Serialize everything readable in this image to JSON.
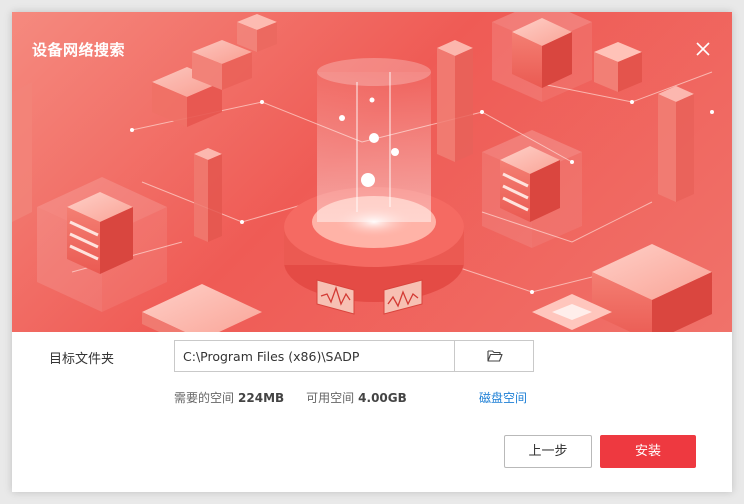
{
  "window": {
    "title": "设备网络搜索"
  },
  "icons": {
    "close": "close-icon",
    "browse": "folder-open-icon"
  },
  "install_dir": {
    "label": "目标文件夹",
    "value": "C:\\Program Files (x86)\\SADP"
  },
  "space": {
    "required_label": "需要的空间",
    "required_value": "224MB",
    "available_label": "可用空间",
    "available_value": "4.00GB",
    "disk_link": "磁盘空间"
  },
  "buttons": {
    "back": "上一步",
    "install": "安装"
  },
  "colors": {
    "accent": "#ee3940",
    "link": "#1f80d6",
    "banner": "#ef5b55"
  }
}
